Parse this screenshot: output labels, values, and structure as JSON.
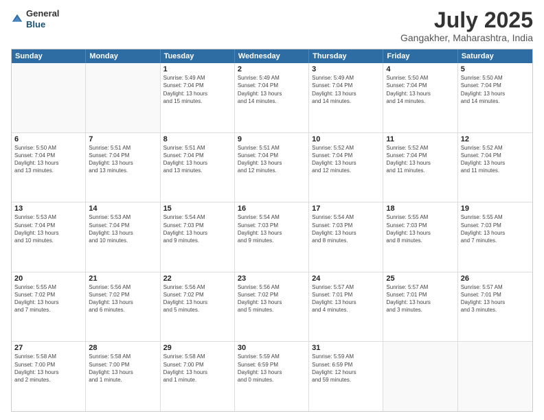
{
  "logo": {
    "line1": "General",
    "line2": "Blue"
  },
  "title": "July 2025",
  "location": "Gangakher, Maharashtra, India",
  "headers": [
    "Sunday",
    "Monday",
    "Tuesday",
    "Wednesday",
    "Thursday",
    "Friday",
    "Saturday"
  ],
  "rows": [
    [
      {
        "day": "",
        "info": ""
      },
      {
        "day": "",
        "info": ""
      },
      {
        "day": "1",
        "info": "Sunrise: 5:49 AM\nSunset: 7:04 PM\nDaylight: 13 hours\nand 15 minutes."
      },
      {
        "day": "2",
        "info": "Sunrise: 5:49 AM\nSunset: 7:04 PM\nDaylight: 13 hours\nand 14 minutes."
      },
      {
        "day": "3",
        "info": "Sunrise: 5:49 AM\nSunset: 7:04 PM\nDaylight: 13 hours\nand 14 minutes."
      },
      {
        "day": "4",
        "info": "Sunrise: 5:50 AM\nSunset: 7:04 PM\nDaylight: 13 hours\nand 14 minutes."
      },
      {
        "day": "5",
        "info": "Sunrise: 5:50 AM\nSunset: 7:04 PM\nDaylight: 13 hours\nand 14 minutes."
      }
    ],
    [
      {
        "day": "6",
        "info": "Sunrise: 5:50 AM\nSunset: 7:04 PM\nDaylight: 13 hours\nand 13 minutes."
      },
      {
        "day": "7",
        "info": "Sunrise: 5:51 AM\nSunset: 7:04 PM\nDaylight: 13 hours\nand 13 minutes."
      },
      {
        "day": "8",
        "info": "Sunrise: 5:51 AM\nSunset: 7:04 PM\nDaylight: 13 hours\nand 13 minutes."
      },
      {
        "day": "9",
        "info": "Sunrise: 5:51 AM\nSunset: 7:04 PM\nDaylight: 13 hours\nand 12 minutes."
      },
      {
        "day": "10",
        "info": "Sunrise: 5:52 AM\nSunset: 7:04 PM\nDaylight: 13 hours\nand 12 minutes."
      },
      {
        "day": "11",
        "info": "Sunrise: 5:52 AM\nSunset: 7:04 PM\nDaylight: 13 hours\nand 11 minutes."
      },
      {
        "day": "12",
        "info": "Sunrise: 5:52 AM\nSunset: 7:04 PM\nDaylight: 13 hours\nand 11 minutes."
      }
    ],
    [
      {
        "day": "13",
        "info": "Sunrise: 5:53 AM\nSunset: 7:04 PM\nDaylight: 13 hours\nand 10 minutes."
      },
      {
        "day": "14",
        "info": "Sunrise: 5:53 AM\nSunset: 7:04 PM\nDaylight: 13 hours\nand 10 minutes."
      },
      {
        "day": "15",
        "info": "Sunrise: 5:54 AM\nSunset: 7:03 PM\nDaylight: 13 hours\nand 9 minutes."
      },
      {
        "day": "16",
        "info": "Sunrise: 5:54 AM\nSunset: 7:03 PM\nDaylight: 13 hours\nand 9 minutes."
      },
      {
        "day": "17",
        "info": "Sunrise: 5:54 AM\nSunset: 7:03 PM\nDaylight: 13 hours\nand 8 minutes."
      },
      {
        "day": "18",
        "info": "Sunrise: 5:55 AM\nSunset: 7:03 PM\nDaylight: 13 hours\nand 8 minutes."
      },
      {
        "day": "19",
        "info": "Sunrise: 5:55 AM\nSunset: 7:03 PM\nDaylight: 13 hours\nand 7 minutes."
      }
    ],
    [
      {
        "day": "20",
        "info": "Sunrise: 5:55 AM\nSunset: 7:02 PM\nDaylight: 13 hours\nand 7 minutes."
      },
      {
        "day": "21",
        "info": "Sunrise: 5:56 AM\nSunset: 7:02 PM\nDaylight: 13 hours\nand 6 minutes."
      },
      {
        "day": "22",
        "info": "Sunrise: 5:56 AM\nSunset: 7:02 PM\nDaylight: 13 hours\nand 5 minutes."
      },
      {
        "day": "23",
        "info": "Sunrise: 5:56 AM\nSunset: 7:02 PM\nDaylight: 13 hours\nand 5 minutes."
      },
      {
        "day": "24",
        "info": "Sunrise: 5:57 AM\nSunset: 7:01 PM\nDaylight: 13 hours\nand 4 minutes."
      },
      {
        "day": "25",
        "info": "Sunrise: 5:57 AM\nSunset: 7:01 PM\nDaylight: 13 hours\nand 3 minutes."
      },
      {
        "day": "26",
        "info": "Sunrise: 5:57 AM\nSunset: 7:01 PM\nDaylight: 13 hours\nand 3 minutes."
      }
    ],
    [
      {
        "day": "27",
        "info": "Sunrise: 5:58 AM\nSunset: 7:00 PM\nDaylight: 13 hours\nand 2 minutes."
      },
      {
        "day": "28",
        "info": "Sunrise: 5:58 AM\nSunset: 7:00 PM\nDaylight: 13 hours\nand 1 minute."
      },
      {
        "day": "29",
        "info": "Sunrise: 5:58 AM\nSunset: 7:00 PM\nDaylight: 13 hours\nand 1 minute."
      },
      {
        "day": "30",
        "info": "Sunrise: 5:59 AM\nSunset: 6:59 PM\nDaylight: 13 hours\nand 0 minutes."
      },
      {
        "day": "31",
        "info": "Sunrise: 5:59 AM\nSunset: 6:59 PM\nDaylight: 12 hours\nand 59 minutes."
      },
      {
        "day": "",
        "info": ""
      },
      {
        "day": "",
        "info": ""
      }
    ]
  ]
}
